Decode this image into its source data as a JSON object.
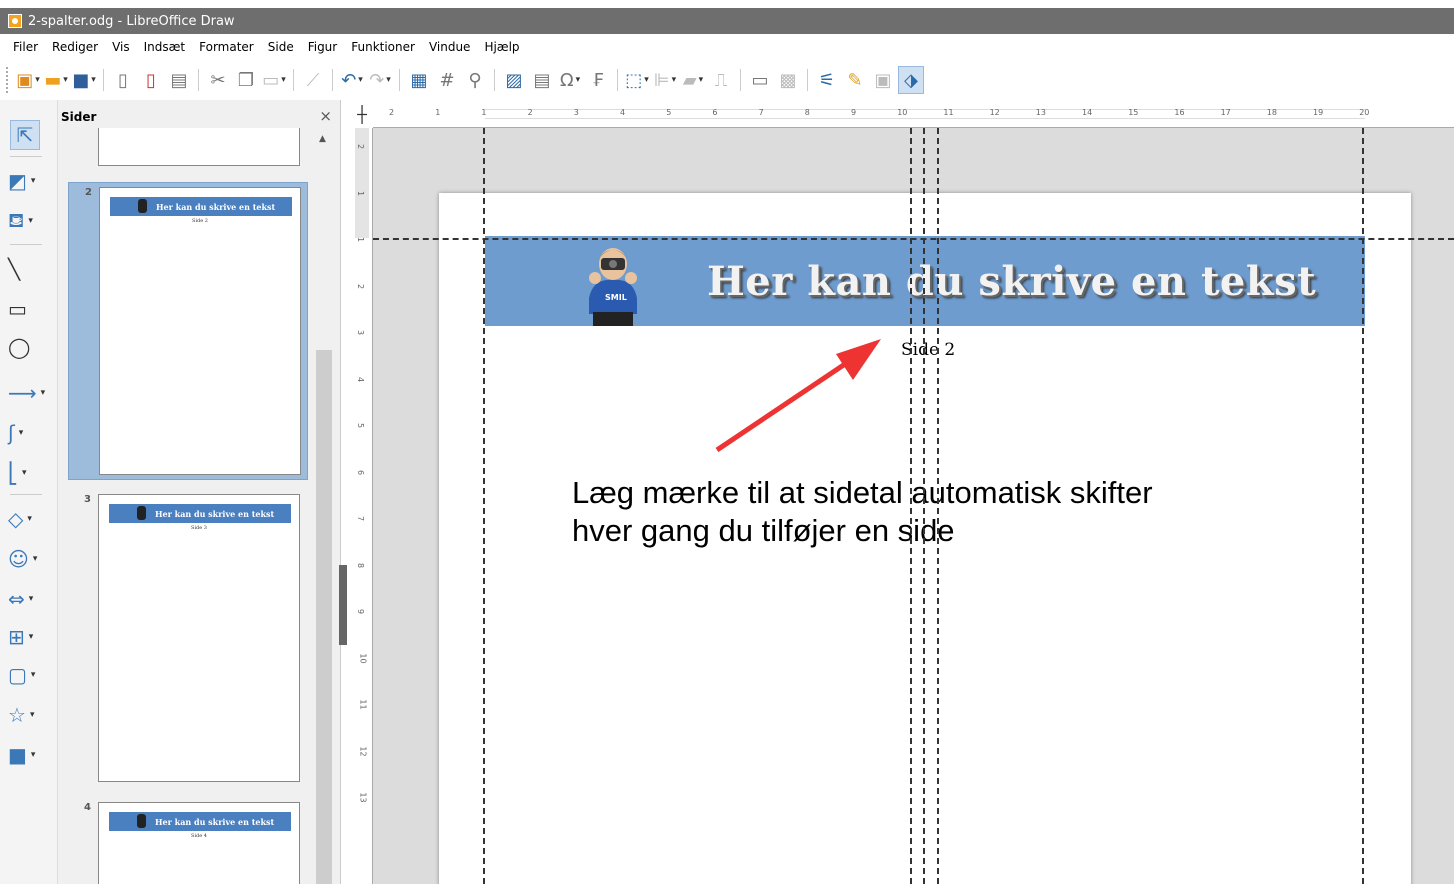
{
  "window": {
    "title": "2-spalter.odg - LibreOffice Draw"
  },
  "menu": [
    "Filer",
    "Rediger",
    "Vis",
    "Indsæt",
    "Formater",
    "Side",
    "Figur",
    "Funktioner",
    "Vindue",
    "Hjælp"
  ],
  "toolbar": {
    "icons": [
      "new-document-icon",
      "open-folder-icon",
      "save-icon",
      "export-icon",
      "export-pdf-icon",
      "print-icon",
      "cut-icon",
      "copy-icon",
      "paste-icon",
      "clone-formatting-icon",
      "undo-icon",
      "redo-icon",
      "grid-icon",
      "helplines-icon",
      "zoom-icon",
      "image-icon",
      "text-box-icon",
      "special-character-icon",
      "fontwork-icon",
      "transform-icon",
      "align-icon",
      "arrange-icon",
      "distribute-icon",
      "shadow-icon",
      "crop-icon",
      "points-icon",
      "glue-points-icon",
      "toggle-extrusion-icon",
      "select-icon"
    ]
  },
  "left_tools": [
    "select-icon",
    "line-color-icon",
    "fill-color-icon",
    "line-icon",
    "rectangle-icon",
    "ellipse-icon",
    "arrow-line-icon",
    "curve-icon",
    "connector-icon",
    "basic-shapes-icon",
    "symbol-shapes-icon",
    "block-arrows-icon",
    "flowchart-icon",
    "callouts-icon",
    "stars-icon",
    "3d-objects-icon"
  ],
  "pages_panel": {
    "title": "Sider",
    "close": "×",
    "pages": [
      {
        "number": "2",
        "banner": "Her kan du skrive en tekst",
        "side": "Side 2"
      },
      {
        "number": "3",
        "banner": "Her kan du skrive en tekst",
        "side": "Side 3"
      },
      {
        "number": "4",
        "banner": "Her kan du skrive en tekst",
        "side": "Side 4"
      }
    ]
  },
  "ruler": {
    "h_ticks": [
      "2",
      "1",
      "1",
      "2",
      "3",
      "4",
      "5",
      "6",
      "7",
      "8",
      "9",
      "10",
      "11",
      "12",
      "13",
      "14",
      "15",
      "16",
      "17",
      "18",
      "19",
      "20"
    ],
    "v_ticks": [
      "2",
      "1",
      "1",
      "2",
      "3",
      "4",
      "5",
      "6",
      "7",
      "8",
      "9",
      "10",
      "11",
      "12",
      "13"
    ]
  },
  "document": {
    "banner_title": "Her kan du skrive en tekst",
    "page_label": "Side 2",
    "note_line1": "Læg mærke til at sidetal automatisk skifter",
    "note_line2": "hver gang du tilføjer en side",
    "banner_color": "#6e9ccf",
    "arrow_color": "#ee3333"
  }
}
